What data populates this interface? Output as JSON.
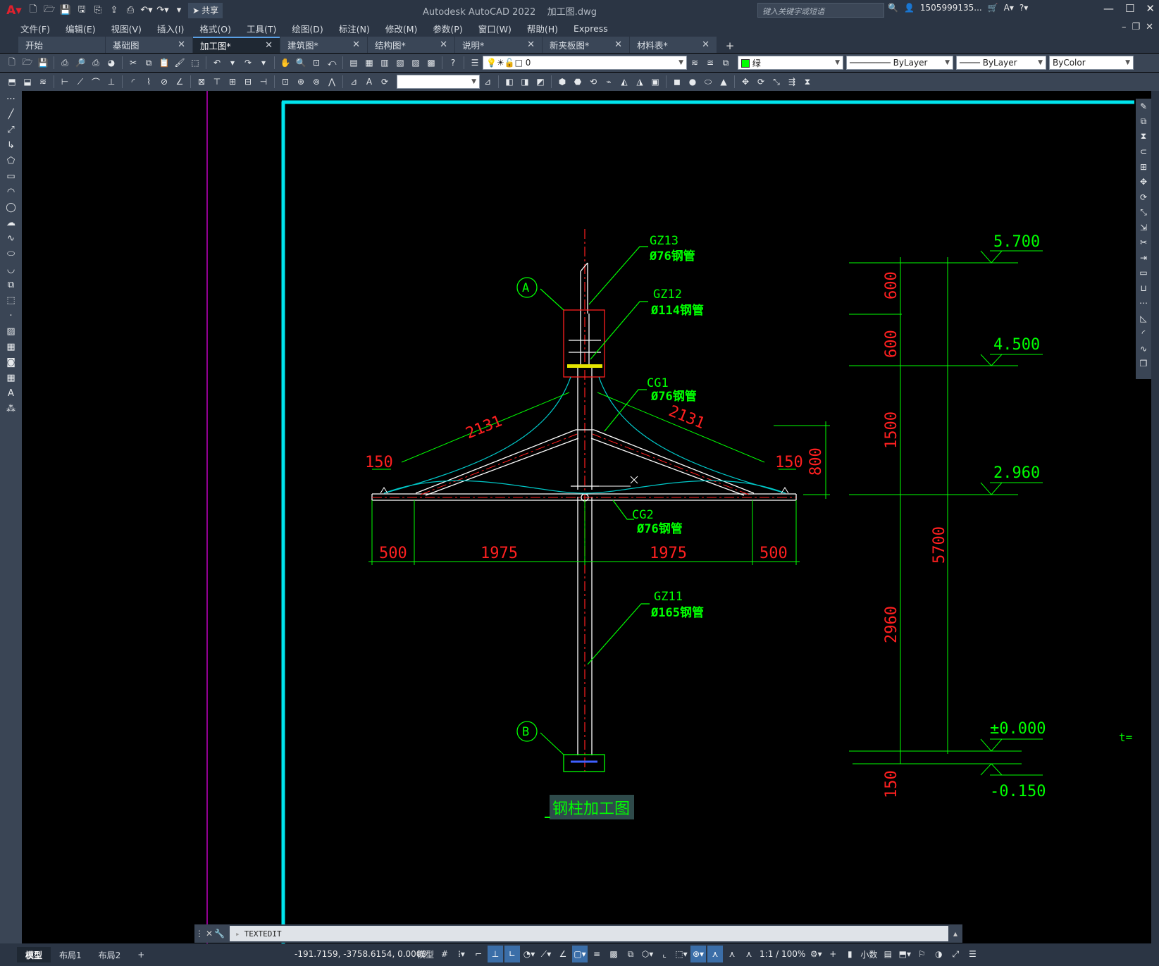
{
  "app": {
    "title": "Autodesk AutoCAD 2022",
    "filename": "加工图.dwg",
    "share_label": "共享",
    "search_placeholder": "键入关键字或短语",
    "user": "1505999135...",
    "colors": {
      "chrome": "#2b3544",
      "toolbar": "#3a4555",
      "canvas": "#000000",
      "frame": "#00e5ee",
      "green": "#00ff00",
      "red": "#ff0000",
      "cyan": "#00cccc"
    }
  },
  "menubar": [
    "文件(F)",
    "编辑(E)",
    "视图(V)",
    "插入(I)",
    "格式(O)",
    "工具(T)",
    "绘图(D)",
    "标注(N)",
    "修改(M)",
    "参数(P)",
    "窗口(W)",
    "帮助(H)",
    "Express"
  ],
  "tabs": [
    {
      "label": "开始",
      "closable": false,
      "active": false
    },
    {
      "label": "基础图",
      "closable": true,
      "active": false
    },
    {
      "label": "加工图*",
      "closable": true,
      "active": true
    },
    {
      "label": "建筑图*",
      "closable": true,
      "active": false
    },
    {
      "label": "结构图*",
      "closable": true,
      "active": false
    },
    {
      "label": "说明*",
      "closable": true,
      "active": false
    },
    {
      "label": "新夹板图*",
      "closable": true,
      "active": false
    },
    {
      "label": "材料表*",
      "closable": true,
      "active": false
    }
  ],
  "properties": {
    "layer": "0",
    "color": "绿",
    "linetype": "ByLayer",
    "lineweight": "ByLayer",
    "plotstyle": "ByColor"
  },
  "drawing": {
    "title": "钢柱加工图",
    "callouts": [
      {
        "id": "GZ13",
        "spec": "Ø76钢管"
      },
      {
        "id": "GZ12",
        "spec": "Ø114钢管"
      },
      {
        "id": "CG1",
        "spec": "Ø76钢管"
      },
      {
        "id": "CG2",
        "spec": "Ø76钢管"
      },
      {
        "id": "GZ11",
        "spec": "Ø165钢管"
      }
    ],
    "axis_labels": [
      "A",
      "B"
    ],
    "dims": {
      "diag_left": "2131",
      "diag_right": "2131",
      "end_left": "150",
      "end_right": "150",
      "rise": "800",
      "bottom": [
        "500",
        "1975",
        "1975",
        "500"
      ]
    },
    "elevations": {
      "marks": [
        "5.700",
        "4.500",
        "2.960",
        "±0.000",
        "-0.150"
      ],
      "segments": [
        "600",
        "600",
        "1500",
        "2960",
        "150"
      ],
      "total": "5700"
    },
    "edge_text": "t="
  },
  "command": {
    "text": "TEXTEDIT"
  },
  "layout_tabs": [
    "模型",
    "布局1",
    "布局2"
  ],
  "status": {
    "coords": "-191.7159, -3758.6154, 0.0000",
    "space": "模型",
    "scale": "1:1 / 100%",
    "units": "小数"
  }
}
